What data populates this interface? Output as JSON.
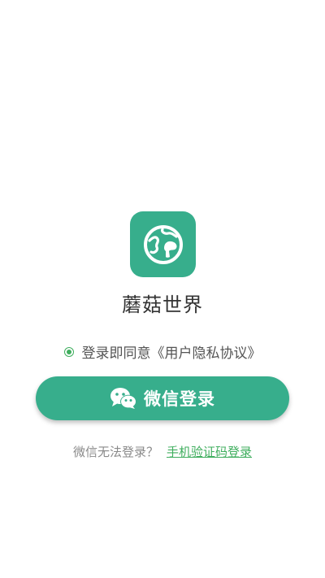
{
  "app": {
    "name": "蘑菇世界",
    "logo_icon": "globe-mushroom-icon",
    "brand_color": "#37ae8c"
  },
  "agreement": {
    "text": "登录即同意《用户隐私协议》",
    "checked": true,
    "radio_color": "#3fae5e"
  },
  "login": {
    "wechat_label": "微信登录",
    "wechat_icon": "wechat-icon"
  },
  "alternative": {
    "question": "微信无法登录？",
    "link": "手机验证码登录",
    "link_color": "#3fae5e"
  }
}
